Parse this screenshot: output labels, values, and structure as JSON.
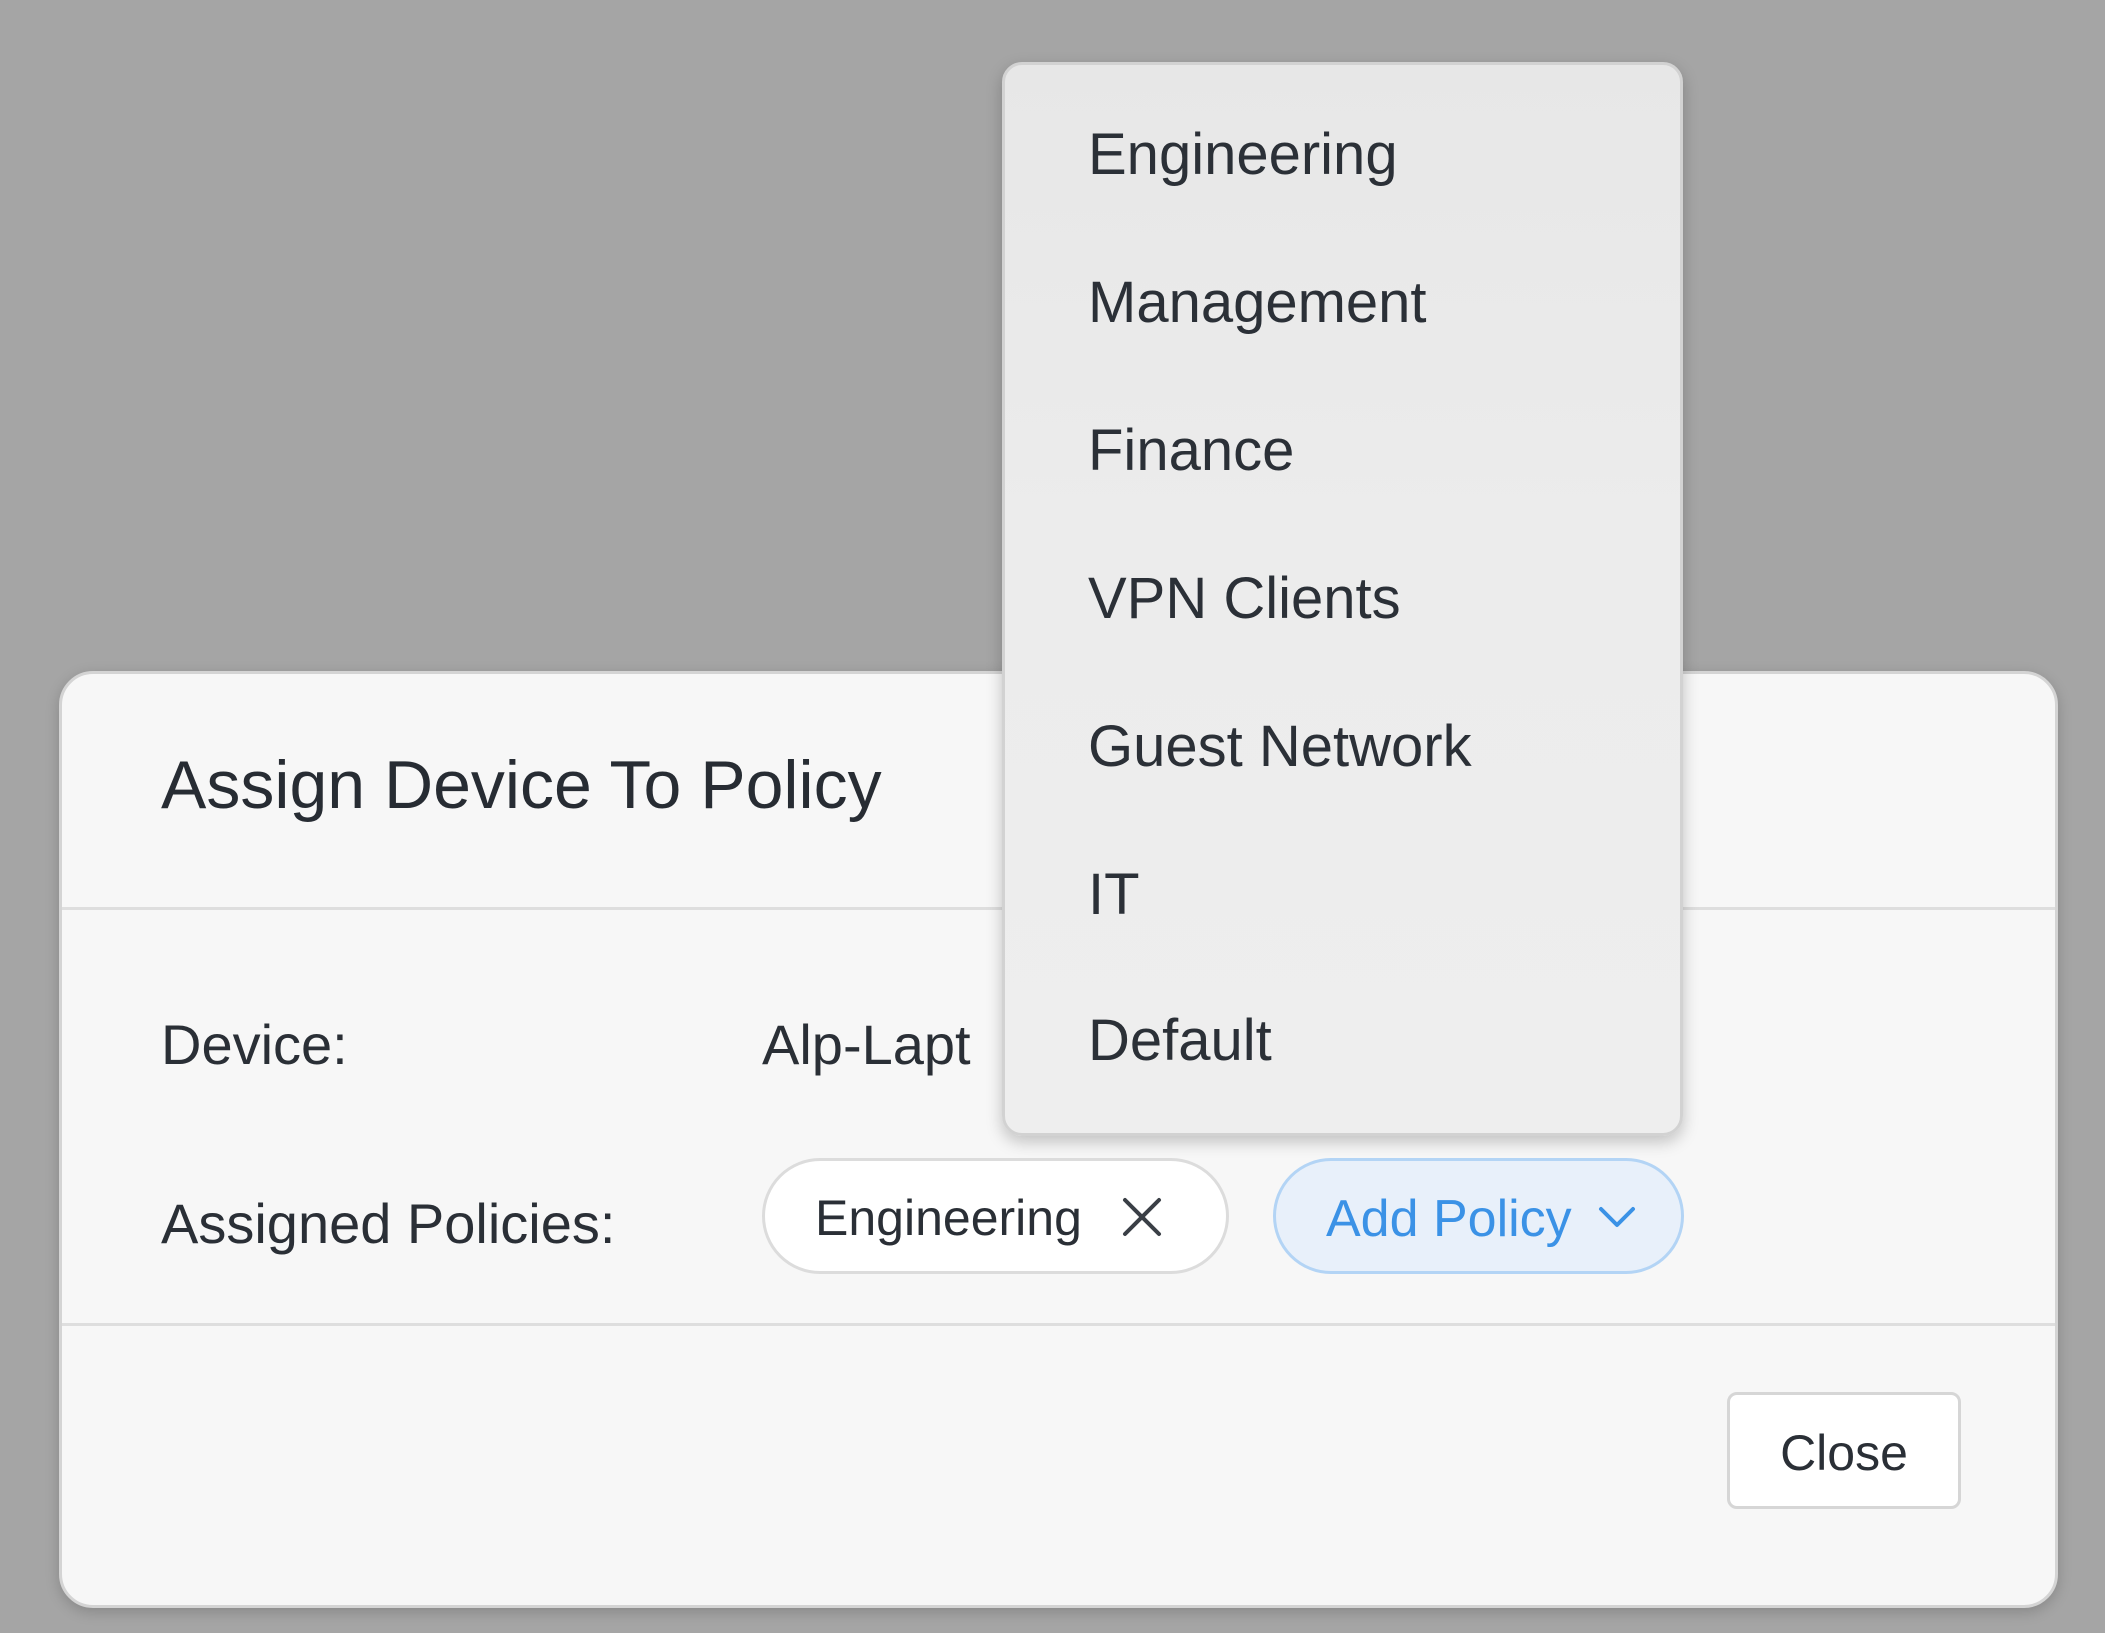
{
  "dialog": {
    "title": "Assign Device To Policy",
    "device_label": "Device:",
    "device_value": "Alp-Lapt",
    "policies_label": "Assigned Policies:",
    "assigned_policies": [
      "Engineering"
    ],
    "add_policy_label": "Add Policy",
    "close_label": "Close"
  },
  "dropdown": {
    "options": [
      "Engineering",
      "Management",
      "Finance",
      "VPN Clients",
      "Guest Network",
      "IT",
      "Default"
    ]
  },
  "icons": {
    "chip_remove": "close-icon",
    "add_policy_chevron": "chevron-down-icon"
  },
  "colors": {
    "backdrop": "#a5a5a5",
    "accent": "#3b92e6",
    "accent_bg": "#e8f0fa",
    "accent_border": "#b3d4f5"
  }
}
